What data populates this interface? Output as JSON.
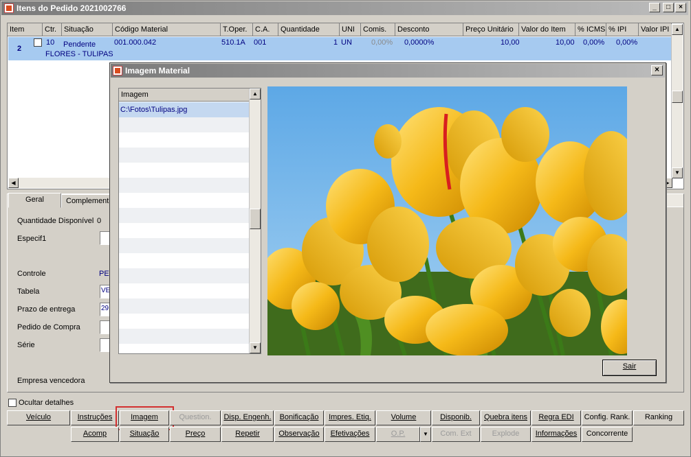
{
  "window": {
    "title": "Itens do Pedido 2021002766",
    "minimize": "_",
    "maximize": "□",
    "close": "×"
  },
  "grid": {
    "columns": [
      "Item",
      "Ctr.",
      "Situação",
      "Código Material",
      "T.Oper.",
      "C.A.",
      "Quantidade",
      "UNI",
      "Comis.",
      "Desconto",
      "Preço Unitário",
      "Valor do Item",
      "% ICMS",
      "% IPI",
      "Valor IPI"
    ],
    "row": {
      "item": "2",
      "ctr": "10",
      "situacao": "Pendente",
      "codigo": "001.000.042",
      "descricao": "FLORES - TULIPAS",
      "toper": "510.1A",
      "ca": "001",
      "quantidade": "1",
      "uni": "UN",
      "comis": "0,00%",
      "desconto": "0,0000%",
      "preco": "10,00",
      "valor": "10,00",
      "icms": "0,00%",
      "ipi": "0,00%"
    }
  },
  "tabs": [
    "Geral",
    "Complemento"
  ],
  "details": {
    "quantidade_label": "Quantidade Disponível",
    "quantidade_value": "0",
    "especif_label": "Especif1",
    "controle_label": "Controle",
    "controle_value": "PEN",
    "tabela_label": "Tabela",
    "tabela_value": "VE",
    "prazo_label": "Prazo de entrega",
    "prazo_value": "29",
    "pedido_label": "Pedido de Compra",
    "serie_label": "Série",
    "empresa_label": "Empresa vencedora"
  },
  "ocultar_label": "Ocultar detalhes",
  "buttons_row1": [
    "Veículo",
    "Instruções",
    "Imagem",
    "Question.",
    "Disp. Engenh.",
    "Bonificação",
    "Impres. Etiq.",
    "Volume",
    "Disponib.",
    "Quebra itens",
    "Regra EDI",
    "Config. Rank.",
    "Ranking"
  ],
  "buttons_row2": [
    "Acomp",
    "Situação",
    "Preço",
    "Repetir",
    "Observação",
    "Efetivações",
    "O.P.",
    "Com. Ext",
    "Explode",
    "Informações",
    "Concorrente"
  ],
  "dialog": {
    "title": "Imagem Material",
    "list_header": "Imagem",
    "path": "C:\\Fotos\\Tulipas.jpg",
    "close": "×",
    "sair_label": "Sair"
  },
  "colors": {
    "selection": "#a6caf0",
    "highlight": "#d32f2f",
    "link_text": "#000080"
  }
}
